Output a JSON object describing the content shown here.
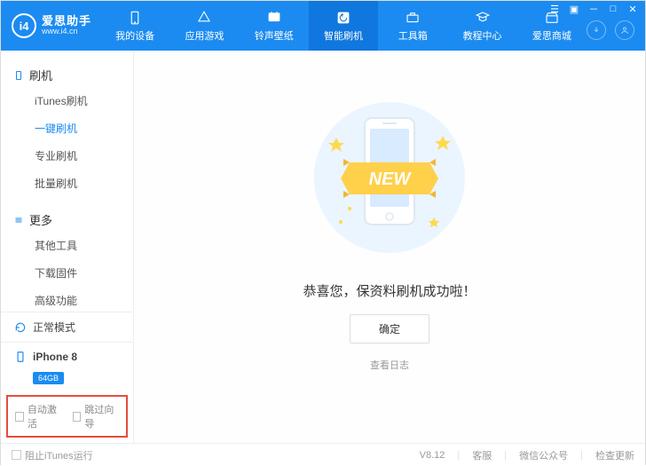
{
  "header": {
    "logo_title": "爱思助手",
    "logo_badge": "i4",
    "logo_url": "www.i4.cn",
    "nav": [
      {
        "label": "我的设备",
        "icon": "device"
      },
      {
        "label": "应用游戏",
        "icon": "apps"
      },
      {
        "label": "铃声壁纸",
        "icon": "wallpaper"
      },
      {
        "label": "智能刷机",
        "icon": "flash",
        "active": true
      },
      {
        "label": "工具箱",
        "icon": "tools"
      },
      {
        "label": "教程中心",
        "icon": "tutorial"
      },
      {
        "label": "爱思商城",
        "icon": "shop"
      }
    ]
  },
  "sidebar": {
    "sections": [
      {
        "title": "刷机",
        "icon": "device",
        "items": [
          {
            "label": "iTunes刷机"
          },
          {
            "label": "一键刷机",
            "active": true
          },
          {
            "label": "专业刷机"
          },
          {
            "label": "批量刷机"
          }
        ]
      },
      {
        "title": "更多",
        "icon": "more",
        "items": [
          {
            "label": "其他工具"
          },
          {
            "label": "下载固件"
          },
          {
            "label": "高级功能"
          }
        ]
      }
    ],
    "mode_label": "正常模式",
    "device_name": "iPhone 8",
    "device_storage": "64GB",
    "auto_activate": "自动激活",
    "skip_guide": "跳过向导"
  },
  "main": {
    "ribbon_text": "NEW",
    "congrats": "恭喜您，保资料刷机成功啦！",
    "ok_label": "确定",
    "log_label": "查看日志"
  },
  "footer": {
    "block_itunes": "阻止iTunes运行",
    "version": "V8.12",
    "support": "客服",
    "wechat": "微信公众号",
    "update": "检查更新"
  }
}
